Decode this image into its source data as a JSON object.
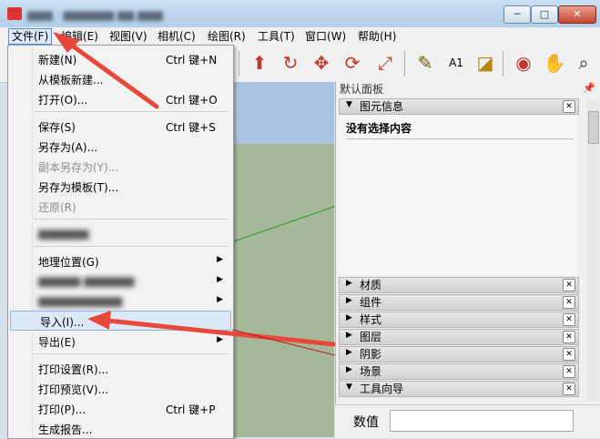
{
  "menubar": {
    "file": "文件(F)",
    "edit": "编辑(E)",
    "view": "视图(V)",
    "camera": "相机(C)",
    "draw": "绘图(R)",
    "tools": "工具(T)",
    "window": "窗口(W)",
    "help": "帮助(H)"
  },
  "file_menu": {
    "new": {
      "label": "新建(N)",
      "shortcut": "Ctrl 键+N"
    },
    "new_from_template": {
      "label": "从模板新建..."
    },
    "open": {
      "label": "打开(O)...",
      "shortcut": "Ctrl 键+O"
    },
    "save": {
      "label": "保存(S)",
      "shortcut": "Ctrl 键+S"
    },
    "save_as": {
      "label": "另存为(A)..."
    },
    "save_copy_as": {
      "label": "副本另存为(Y)..."
    },
    "save_as_template": {
      "label": "另存为模板(T)..."
    },
    "revert": {
      "label": "还原(R)"
    },
    "geo_location": {
      "label": "地理位置(G)"
    },
    "import": {
      "label": "导入(I)..."
    },
    "export": {
      "label": "导出(E)"
    },
    "print_setup": {
      "label": "打印设置(R)..."
    },
    "print_preview": {
      "label": "打印预览(V)..."
    },
    "print": {
      "label": "打印(P)...",
      "shortcut": "Ctrl 键+P"
    },
    "generate_report": {
      "label": "生成报告..."
    }
  },
  "panel": {
    "title": "默认面板",
    "pin_icon": "pin-icon",
    "entity_info": "图元信息",
    "entity_status": "没有选择内容",
    "sections": [
      "材质",
      "组件",
      "样式",
      "图层",
      "阴影",
      "场景",
      "工具向导"
    ]
  },
  "statusbar": {
    "value_label": "数值"
  },
  "colors": {
    "annotation_arrow": "#e8473c",
    "menu_highlight": "#dce9f8",
    "sky": "#a9c4e2",
    "ground": "#a6b89a"
  }
}
